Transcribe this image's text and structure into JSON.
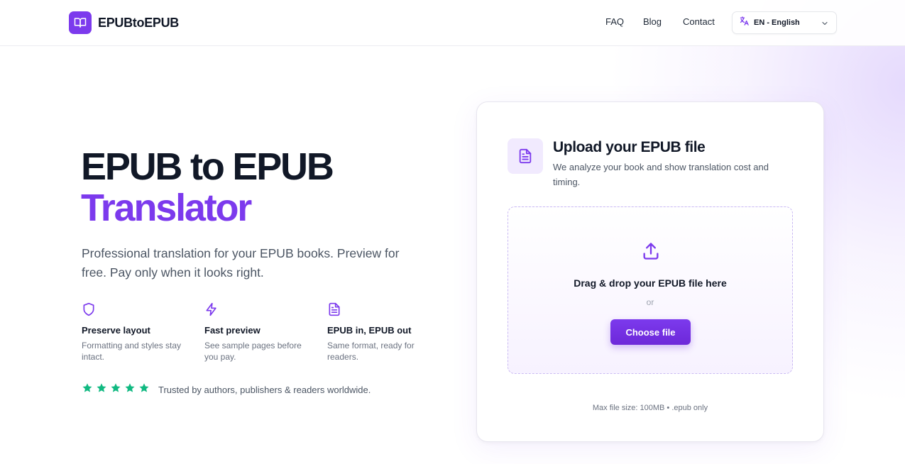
{
  "header": {
    "logo_text": "EPUBtoEPUB",
    "nav": {
      "faq": "FAQ",
      "blog": "Blog",
      "contact": "Contact"
    },
    "language": {
      "selected": "EN - English"
    }
  },
  "hero": {
    "title_line1": "EPUB to EPUB",
    "title_line2": "Translator",
    "subtitle": "Professional translation for your EPUB books. Preview for free. Pay only when it looks right.",
    "features": [
      {
        "icon": "shield-icon",
        "title": "Preserve layout",
        "desc": "Formatting and styles stay intact."
      },
      {
        "icon": "lightning-icon",
        "title": "Fast preview",
        "desc": "See sample pages before you pay."
      },
      {
        "icon": "document-icon",
        "title": "EPUB in, EPUB out",
        "desc": "Same format, ready for readers."
      }
    ],
    "rating": 5,
    "trust_text": "Trusted by authors, publishers & readers worldwide."
  },
  "upload_card": {
    "title": "Upload your EPUB file",
    "description": "We analyze your book and show translation cost and timing.",
    "drop_text": "Drag & drop your EPUB file here",
    "or_text": "or",
    "button_label": "Choose file",
    "limits_text": "Max file size: 100MB • .epub only"
  },
  "colors": {
    "accent": "#7c3aed",
    "star": "#10b981",
    "text_dark": "#111827",
    "text_muted": "#4b5563"
  }
}
